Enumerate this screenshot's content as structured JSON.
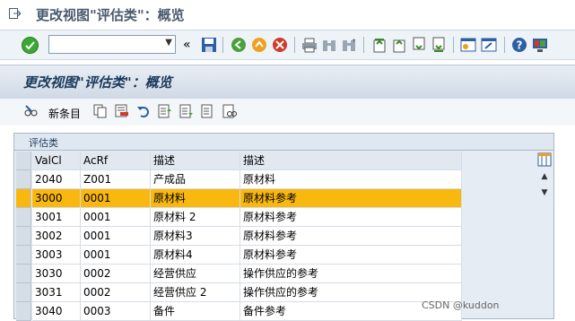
{
  "window": {
    "title": "更改视图\"评估类\"：概览"
  },
  "toolbar": {
    "command_field": ""
  },
  "header": {
    "title": "更改视图\"评估类\"：概览"
  },
  "app_toolbar": {
    "new_entries_label": "新条目"
  },
  "panel": {
    "title": "评估类"
  },
  "table": {
    "columns": [
      "ValCl",
      "AcRf",
      "描述",
      "描述"
    ],
    "rows": [
      [
        "2040",
        "Z001",
        "产成品",
        "原材料"
      ],
      [
        "3000",
        "0001",
        "原材料",
        "原材料参考"
      ],
      [
        "3001",
        "0001",
        "原材料 2",
        "原材料参考"
      ],
      [
        "3002",
        "0001",
        "原材料3",
        "原材料参考"
      ],
      [
        "3003",
        "0001",
        "原材料4",
        "原材料参考"
      ],
      [
        "3030",
        "0002",
        "经营供应",
        "操作供应的参考"
      ],
      [
        "3031",
        "0002",
        "经营供应 2",
        "操作供应的参考"
      ],
      [
        "3040",
        "0003",
        "备件",
        "备件参考"
      ]
    ],
    "selected_row": 1
  },
  "watermark": "CSDN @kuddon",
  "colors": {
    "selected": "#f9b80f",
    "accent": "#1b3a5c"
  }
}
